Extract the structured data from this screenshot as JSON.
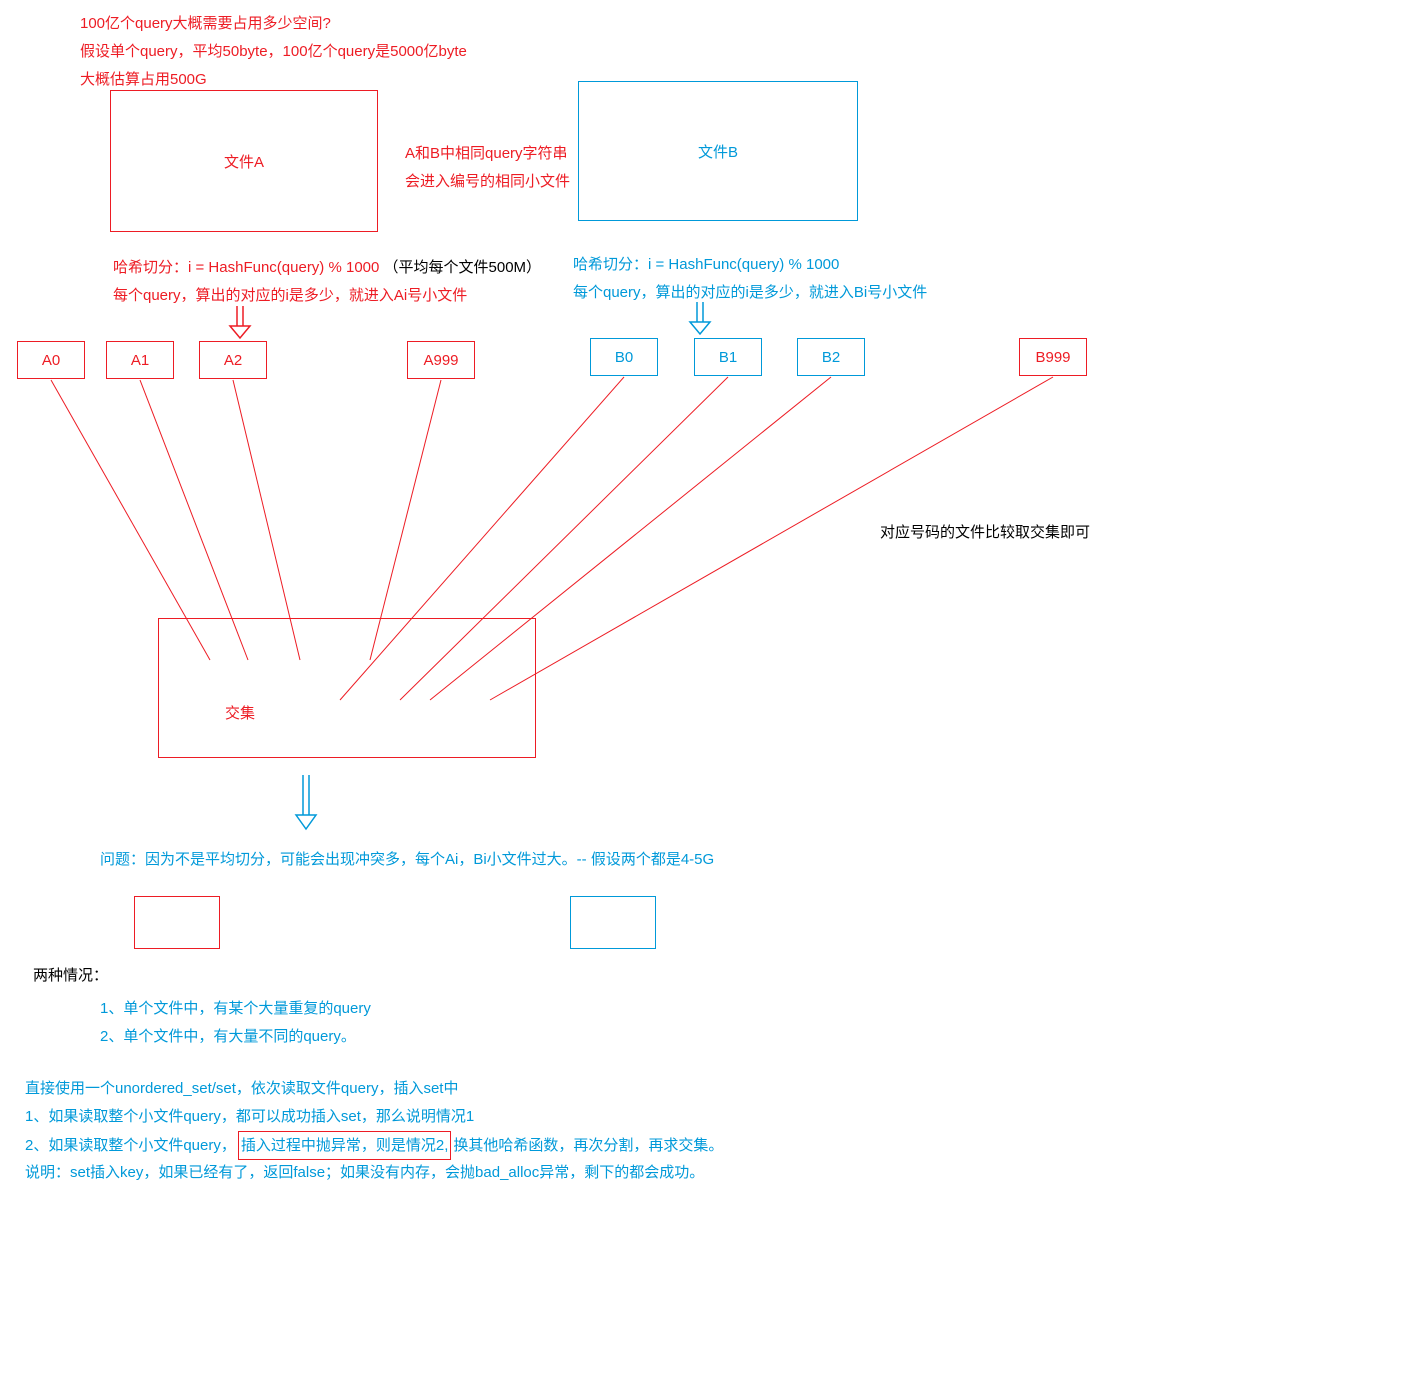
{
  "intro": {
    "line1": "100亿个query大概需要占用多少空间?",
    "line2": "假设单个query，平均50byte，100亿个query是5000亿byte",
    "line3": "大概估算占用500G"
  },
  "fileA": {
    "label": "文件A"
  },
  "fileB": {
    "label": "文件B"
  },
  "middleNote": {
    "line1": "A和B中相同query字符串",
    "line2": "会进入编号的相同小文件"
  },
  "hashA": {
    "line1_pre": "哈希切分：i = HashFunc(query) % 1000",
    "line1_suffix": "（平均每个文件500M）",
    "line2": "每个query，算出的对应的i是多少，就进入Ai号小文件"
  },
  "hashB": {
    "line1": "哈希切分：i = HashFunc(query) % 1000",
    "line2": "每个query，算出的对应的i是多少，就进入Bi号小文件"
  },
  "buckets": {
    "A0": "A0",
    "A1": "A1",
    "A2": "A2",
    "A999": "A999",
    "B0": "B0",
    "B1": "B1",
    "B2": "B2",
    "B999": "B999"
  },
  "intersectNote": "对应号码的文件比较取交集即可",
  "intersection": {
    "label": "交集"
  },
  "problem": "问题：因为不是平均切分，可能会出现冲突多，每个Ai，Bi小文件过大。-- 假设两个都是4-5G",
  "casesTitle": "两种情况：",
  "cases": {
    "c1": "1、单个文件中，有某个大量重复的query",
    "c2": "2、单个文件中，有大量不同的query。"
  },
  "solution": {
    "s1": "直接使用一个unordered_set/set，依次读取文件query，插入set中",
    "s2": "1、如果读取整个小文件query，都可以成功插入set，那么说明情况1",
    "s3_pre": "2、如果读取整个小文件query，",
    "s3_boxed": "插入过程中抛异常，则是情况2,",
    "s3_post": " 换其他哈希函数，再次分割，再求交集。",
    "s4": "说明：set插入key，如果已经有了，返回false；如果没有内存，会抛bad_alloc异常，剩下的都会成功。"
  }
}
